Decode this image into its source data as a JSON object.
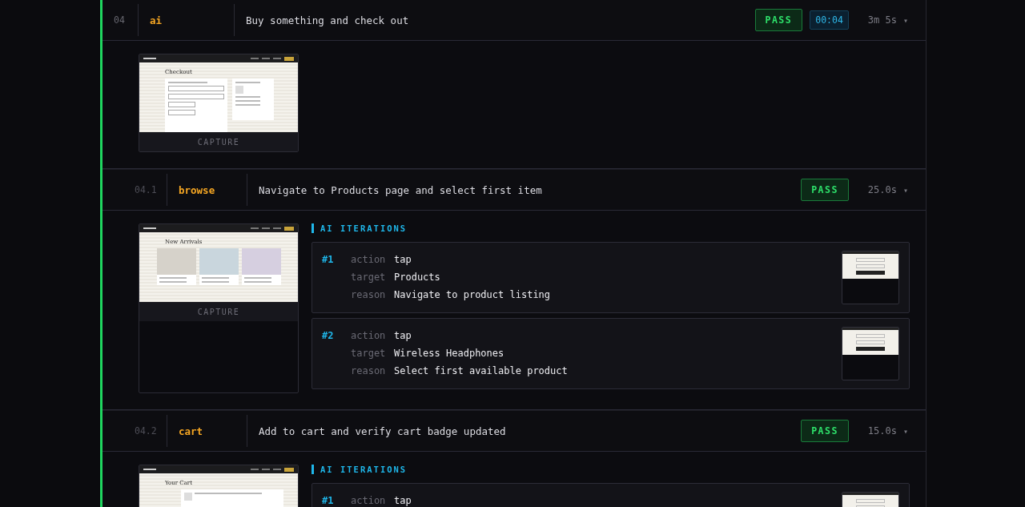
{
  "steps": [
    {
      "kind": "parent",
      "number": "04",
      "name": "ai",
      "description": "Buy something and check out",
      "status": "PASS",
      "timer": "00:04",
      "duration": "3m 5s",
      "caret": "▾",
      "capture": {
        "kind": "checkout",
        "heading": "Checkout",
        "label": "CAPTURE"
      }
    },
    {
      "kind": "sub",
      "number": "04.1",
      "name": "browse",
      "description": "Navigate to Products page and select first item",
      "status": "PASS",
      "duration": "25.0s",
      "caret": "▾",
      "capture": {
        "kind": "grid",
        "heading": "New Arrivals",
        "label": "CAPTURE"
      },
      "iterations": {
        "title": "AI ITERATIONS",
        "items": [
          {
            "index": "#1",
            "fields": [
              {
                "label": "action",
                "value": "tap"
              },
              {
                "label": "target",
                "value": "Products"
              },
              {
                "label": "reason",
                "value": "Navigate to product listing"
              }
            ]
          },
          {
            "index": "#2",
            "fields": [
              {
                "label": "action",
                "value": "tap"
              },
              {
                "label": "target",
                "value": "Wireless Headphones"
              },
              {
                "label": "reason",
                "value": "Select first available product"
              }
            ]
          }
        ]
      }
    },
    {
      "kind": "sub",
      "number": "04.2",
      "name": "cart",
      "description": "Add to cart and verify cart badge updated",
      "status": "PASS",
      "duration": "15.0s",
      "caret": "▾",
      "capture": {
        "kind": "cart",
        "heading": "Your Cart"
      },
      "iterations": {
        "title": "AI ITERATIONS",
        "items": [
          {
            "index": "#1",
            "fields": [
              {
                "label": "action",
                "value": "tap"
              }
            ]
          }
        ]
      }
    }
  ]
}
